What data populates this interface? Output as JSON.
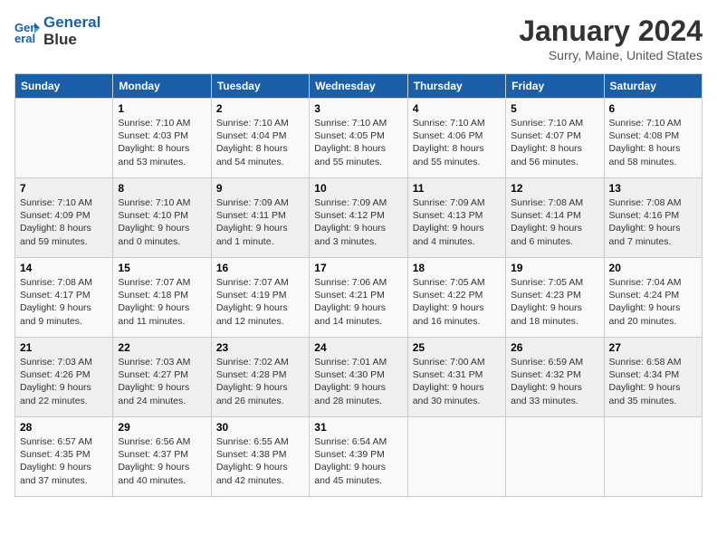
{
  "logo": {
    "line1": "General",
    "line2": "Blue"
  },
  "title": "January 2024",
  "subtitle": "Surry, Maine, United States",
  "headers": [
    "Sunday",
    "Monday",
    "Tuesday",
    "Wednesday",
    "Thursday",
    "Friday",
    "Saturday"
  ],
  "weeks": [
    [
      {
        "day": "",
        "info": ""
      },
      {
        "day": "1",
        "info": "Sunrise: 7:10 AM\nSunset: 4:03 PM\nDaylight: 8 hours\nand 53 minutes."
      },
      {
        "day": "2",
        "info": "Sunrise: 7:10 AM\nSunset: 4:04 PM\nDaylight: 8 hours\nand 54 minutes."
      },
      {
        "day": "3",
        "info": "Sunrise: 7:10 AM\nSunset: 4:05 PM\nDaylight: 8 hours\nand 55 minutes."
      },
      {
        "day": "4",
        "info": "Sunrise: 7:10 AM\nSunset: 4:06 PM\nDaylight: 8 hours\nand 55 minutes."
      },
      {
        "day": "5",
        "info": "Sunrise: 7:10 AM\nSunset: 4:07 PM\nDaylight: 8 hours\nand 56 minutes."
      },
      {
        "day": "6",
        "info": "Sunrise: 7:10 AM\nSunset: 4:08 PM\nDaylight: 8 hours\nand 58 minutes."
      }
    ],
    [
      {
        "day": "7",
        "info": "Sunrise: 7:10 AM\nSunset: 4:09 PM\nDaylight: 8 hours\nand 59 minutes."
      },
      {
        "day": "8",
        "info": "Sunrise: 7:10 AM\nSunset: 4:10 PM\nDaylight: 9 hours\nand 0 minutes."
      },
      {
        "day": "9",
        "info": "Sunrise: 7:09 AM\nSunset: 4:11 PM\nDaylight: 9 hours\nand 1 minute."
      },
      {
        "day": "10",
        "info": "Sunrise: 7:09 AM\nSunset: 4:12 PM\nDaylight: 9 hours\nand 3 minutes."
      },
      {
        "day": "11",
        "info": "Sunrise: 7:09 AM\nSunset: 4:13 PM\nDaylight: 9 hours\nand 4 minutes."
      },
      {
        "day": "12",
        "info": "Sunrise: 7:08 AM\nSunset: 4:14 PM\nDaylight: 9 hours\nand 6 minutes."
      },
      {
        "day": "13",
        "info": "Sunrise: 7:08 AM\nSunset: 4:16 PM\nDaylight: 9 hours\nand 7 minutes."
      }
    ],
    [
      {
        "day": "14",
        "info": "Sunrise: 7:08 AM\nSunset: 4:17 PM\nDaylight: 9 hours\nand 9 minutes."
      },
      {
        "day": "15",
        "info": "Sunrise: 7:07 AM\nSunset: 4:18 PM\nDaylight: 9 hours\nand 11 minutes."
      },
      {
        "day": "16",
        "info": "Sunrise: 7:07 AM\nSunset: 4:19 PM\nDaylight: 9 hours\nand 12 minutes."
      },
      {
        "day": "17",
        "info": "Sunrise: 7:06 AM\nSunset: 4:21 PM\nDaylight: 9 hours\nand 14 minutes."
      },
      {
        "day": "18",
        "info": "Sunrise: 7:05 AM\nSunset: 4:22 PM\nDaylight: 9 hours\nand 16 minutes."
      },
      {
        "day": "19",
        "info": "Sunrise: 7:05 AM\nSunset: 4:23 PM\nDaylight: 9 hours\nand 18 minutes."
      },
      {
        "day": "20",
        "info": "Sunrise: 7:04 AM\nSunset: 4:24 PM\nDaylight: 9 hours\nand 20 minutes."
      }
    ],
    [
      {
        "day": "21",
        "info": "Sunrise: 7:03 AM\nSunset: 4:26 PM\nDaylight: 9 hours\nand 22 minutes."
      },
      {
        "day": "22",
        "info": "Sunrise: 7:03 AM\nSunset: 4:27 PM\nDaylight: 9 hours\nand 24 minutes."
      },
      {
        "day": "23",
        "info": "Sunrise: 7:02 AM\nSunset: 4:28 PM\nDaylight: 9 hours\nand 26 minutes."
      },
      {
        "day": "24",
        "info": "Sunrise: 7:01 AM\nSunset: 4:30 PM\nDaylight: 9 hours\nand 28 minutes."
      },
      {
        "day": "25",
        "info": "Sunrise: 7:00 AM\nSunset: 4:31 PM\nDaylight: 9 hours\nand 30 minutes."
      },
      {
        "day": "26",
        "info": "Sunrise: 6:59 AM\nSunset: 4:32 PM\nDaylight: 9 hours\nand 33 minutes."
      },
      {
        "day": "27",
        "info": "Sunrise: 6:58 AM\nSunset: 4:34 PM\nDaylight: 9 hours\nand 35 minutes."
      }
    ],
    [
      {
        "day": "28",
        "info": "Sunrise: 6:57 AM\nSunset: 4:35 PM\nDaylight: 9 hours\nand 37 minutes."
      },
      {
        "day": "29",
        "info": "Sunrise: 6:56 AM\nSunset: 4:37 PM\nDaylight: 9 hours\nand 40 minutes."
      },
      {
        "day": "30",
        "info": "Sunrise: 6:55 AM\nSunset: 4:38 PM\nDaylight: 9 hours\nand 42 minutes."
      },
      {
        "day": "31",
        "info": "Sunrise: 6:54 AM\nSunset: 4:39 PM\nDaylight: 9 hours\nand 45 minutes."
      },
      {
        "day": "",
        "info": ""
      },
      {
        "day": "",
        "info": ""
      },
      {
        "day": "",
        "info": ""
      }
    ]
  ]
}
